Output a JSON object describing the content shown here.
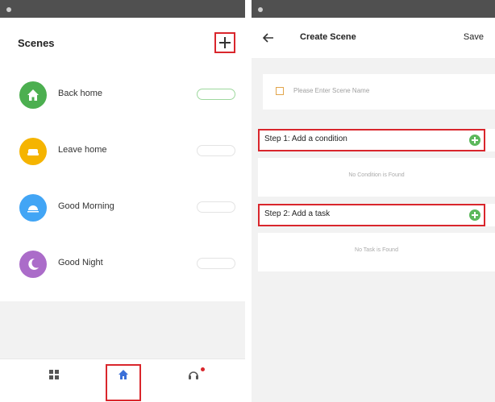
{
  "left_screen": {
    "status": {
      "left": "",
      "right": ""
    },
    "header": {
      "title": "Scenes",
      "add_label": "+"
    },
    "scenes": [
      {
        "name": "Back home",
        "tag": "",
        "active": true,
        "icon": "home-icon",
        "color": "#4caf50"
      },
      {
        "name": "Leave home",
        "tag": "",
        "active": false,
        "icon": "sofa-icon",
        "color": "#f5b400"
      },
      {
        "name": "Good Morning",
        "tag": "",
        "active": false,
        "icon": "sunrise-icon",
        "color": "#42a5f5"
      },
      {
        "name": "Good Night",
        "tag": "",
        "active": false,
        "icon": "moon-icon",
        "color": "#ab6cc9"
      }
    ],
    "nav": [
      {
        "label": "",
        "icon": "grid-icon"
      },
      {
        "label": "",
        "icon": "house-icon"
      },
      {
        "label": "",
        "icon": "headset-icon"
      }
    ]
  },
  "right_screen": {
    "status": {
      "left": "",
      "right": ""
    },
    "header": {
      "back": "←",
      "title": "Create Scene",
      "save": "Save"
    },
    "name_field": {
      "placeholder": "Please Enter Scene Name",
      "icon": "edit-icon"
    },
    "step1": {
      "label": "Step 1: Add a condition",
      "empty": "No Condition is Found"
    },
    "step2": {
      "label": "Step 2: Add a task",
      "empty": "No Task is Found"
    }
  },
  "colors": {
    "highlight": "#d9262c",
    "accent_green": "#5cb85c",
    "status_bar": "#505050"
  }
}
